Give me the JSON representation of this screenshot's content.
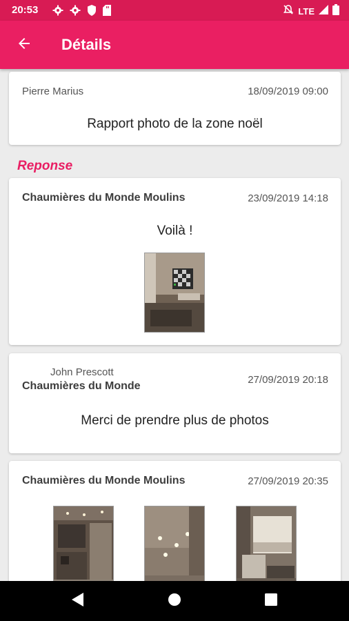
{
  "status_bar": {
    "time": "20:53",
    "network": "LTE",
    "left_icons": [
      "settings-icon",
      "settings-icon",
      "shield-icon",
      "sd-card-icon"
    ],
    "right_icons": [
      "mute-icon",
      "signal-icon",
      "battery-icon"
    ]
  },
  "app_bar": {
    "title": "Détails",
    "back_icon": "arrow-left-icon",
    "color": "#ea1f62"
  },
  "request": {
    "author": "Pierre Marius",
    "date": "18/09/2019 09:00",
    "message": "Rapport photo de la zone noël"
  },
  "responses_label": "Reponse",
  "responses": [
    {
      "company": "Chaumières du Monde Moulins",
      "date": "23/09/2019 14:18",
      "message": "Voilà !",
      "photos": 1
    },
    {
      "author": "John Prescott",
      "company": "Chaumières du Monde",
      "date": "27/09/2019 20:18",
      "message": "Merci de prendre plus de photos"
    },
    {
      "company": "Chaumières du Monde Moulins",
      "date": "27/09/2019 20:35",
      "photos": 3
    }
  ],
  "nav_bar": {
    "icons": [
      "back-triangle-icon",
      "home-circle-icon",
      "recents-square-icon"
    ]
  },
  "colors": {
    "accent": "#e91e63",
    "status_bar": "#d81b54",
    "background": "#ececec"
  }
}
